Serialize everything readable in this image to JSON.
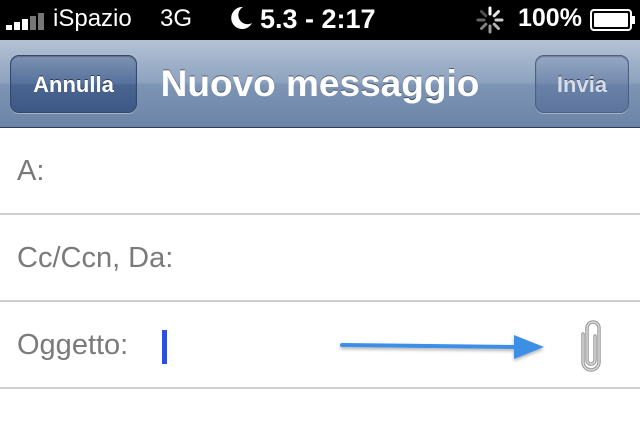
{
  "status_bar": {
    "carrier": "iSpazio",
    "network": "3G",
    "time": "5.3 - 2:17",
    "battery": "100%",
    "icons": [
      "signal-icon",
      "moon-icon",
      "activity-spinner-icon",
      "battery-icon"
    ]
  },
  "nav": {
    "cancel_label": "Annulla",
    "title": "Nuovo messaggio",
    "send_label": "Invia"
  },
  "fields": {
    "to_label": "A:",
    "cc_label": "Cc/Ccn, Da:",
    "subject_label": "Oggetto:",
    "subject_value": ""
  },
  "icons": {
    "attachment": "paperclip-icon",
    "annotation": "arrow-right-icon"
  },
  "colors": {
    "nav_bar": "#8ea3bf",
    "nav_button": "#4a6590",
    "cursor": "#2c4fe0",
    "arrow": "#3d8fe6",
    "label": "#7a7a7a",
    "divider": "#cfcfcf"
  }
}
